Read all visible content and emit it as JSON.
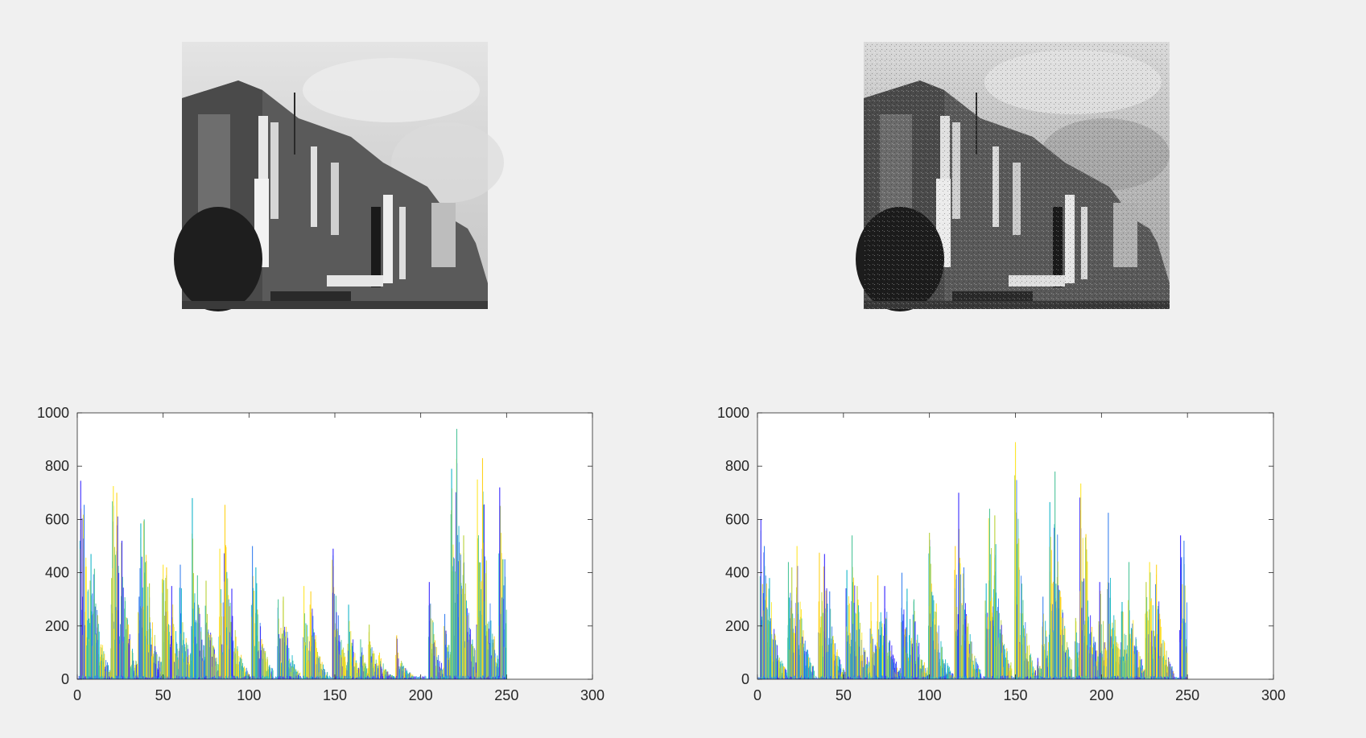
{
  "figure": {
    "background": "#f0f0f0"
  },
  "images": [
    {
      "content": "grayscale photo of building facade with vertical signboards and trees, original"
    },
    {
      "content": "grayscale photo of building facade with vertical signboards and trees, with added noise"
    }
  ],
  "chart_data": [
    {
      "type": "bar",
      "plot_style": "multi-colored histogram lines",
      "xlim": [
        0,
        300
      ],
      "ylim": [
        0,
        1000
      ],
      "xticks": [
        0,
        50,
        100,
        150,
        200,
        250,
        300
      ],
      "yticks": [
        0,
        200,
        400,
        600,
        800,
        1000
      ],
      "colors": [
        "#3a2aff",
        "#3b82f0",
        "#17b7c9",
        "#4ec59a",
        "#b8d23a",
        "#ffe62b",
        "#ffd21c"
      ],
      "bin_range": [
        0,
        250
      ],
      "peaks": [
        {
          "x": 2,
          "y": 745
        },
        {
          "x": 4,
          "y": 655
        },
        {
          "x": 8,
          "y": 470
        },
        {
          "x": 10,
          "y": 415
        },
        {
          "x": 20,
          "y": 380
        },
        {
          "x": 21,
          "y": 725
        },
        {
          "x": 23,
          "y": 700
        },
        {
          "x": 26,
          "y": 520
        },
        {
          "x": 36,
          "y": 310
        },
        {
          "x": 37,
          "y": 585
        },
        {
          "x": 39,
          "y": 600
        },
        {
          "x": 42,
          "y": 360
        },
        {
          "x": 50,
          "y": 430
        },
        {
          "x": 52,
          "y": 420
        },
        {
          "x": 55,
          "y": 350
        },
        {
          "x": 60,
          "y": 430
        },
        {
          "x": 67,
          "y": 680
        },
        {
          "x": 70,
          "y": 390
        },
        {
          "x": 75,
          "y": 370
        },
        {
          "x": 83,
          "y": 490
        },
        {
          "x": 86,
          "y": 655
        },
        {
          "x": 90,
          "y": 340
        },
        {
          "x": 102,
          "y": 500
        },
        {
          "x": 104,
          "y": 420
        },
        {
          "x": 117,
          "y": 300
        },
        {
          "x": 120,
          "y": 310
        },
        {
          "x": 132,
          "y": 350
        },
        {
          "x": 136,
          "y": 330
        },
        {
          "x": 149,
          "y": 490
        },
        {
          "x": 152,
          "y": 240
        },
        {
          "x": 158,
          "y": 280
        },
        {
          "x": 165,
          "y": 150
        },
        {
          "x": 170,
          "y": 205
        },
        {
          "x": 176,
          "y": 100
        },
        {
          "x": 186,
          "y": 165
        },
        {
          "x": 205,
          "y": 365
        },
        {
          "x": 214,
          "y": 245
        },
        {
          "x": 218,
          "y": 790
        },
        {
          "x": 221,
          "y": 940
        },
        {
          "x": 225,
          "y": 540
        },
        {
          "x": 233,
          "y": 750
        },
        {
          "x": 236,
          "y": 830
        },
        {
          "x": 246,
          "y": 720
        },
        {
          "x": 249,
          "y": 450
        }
      ]
    },
    {
      "type": "bar",
      "plot_style": "multi-colored histogram lines",
      "xlim": [
        0,
        300
      ],
      "ylim": [
        0,
        1000
      ],
      "xticks": [
        0,
        50,
        100,
        150,
        200,
        250,
        300
      ],
      "yticks": [
        0,
        200,
        400,
        600,
        800,
        1000
      ],
      "colors": [
        "#3a2aff",
        "#3b82f0",
        "#17b7c9",
        "#4ec59a",
        "#b8d23a",
        "#ffe62b",
        "#ffd21c"
      ],
      "bin_range": [
        0,
        250
      ],
      "peaks": [
        {
          "x": 2,
          "y": 600
        },
        {
          "x": 4,
          "y": 500
        },
        {
          "x": 7,
          "y": 380
        },
        {
          "x": 18,
          "y": 440
        },
        {
          "x": 20,
          "y": 420
        },
        {
          "x": 23,
          "y": 500
        },
        {
          "x": 36,
          "y": 475
        },
        {
          "x": 39,
          "y": 470
        },
        {
          "x": 42,
          "y": 330
        },
        {
          "x": 52,
          "y": 410
        },
        {
          "x": 55,
          "y": 540
        },
        {
          "x": 58,
          "y": 350
        },
        {
          "x": 66,
          "y": 290
        },
        {
          "x": 70,
          "y": 390
        },
        {
          "x": 74,
          "y": 350
        },
        {
          "x": 84,
          "y": 400
        },
        {
          "x": 87,
          "y": 340
        },
        {
          "x": 91,
          "y": 300
        },
        {
          "x": 100,
          "y": 550
        },
        {
          "x": 104,
          "y": 285
        },
        {
          "x": 115,
          "y": 500
        },
        {
          "x": 117,
          "y": 700
        },
        {
          "x": 120,
          "y": 420
        },
        {
          "x": 133,
          "y": 360
        },
        {
          "x": 135,
          "y": 640
        },
        {
          "x": 138,
          "y": 615
        },
        {
          "x": 150,
          "y": 890
        },
        {
          "x": 152,
          "y": 420
        },
        {
          "x": 163,
          "y": 80
        },
        {
          "x": 166,
          "y": 310
        },
        {
          "x": 170,
          "y": 665
        },
        {
          "x": 173,
          "y": 780
        },
        {
          "x": 185,
          "y": 230
        },
        {
          "x": 188,
          "y": 735
        },
        {
          "x": 191,
          "y": 545
        },
        {
          "x": 199,
          "y": 365
        },
        {
          "x": 204,
          "y": 625
        },
        {
          "x": 212,
          "y": 290
        },
        {
          "x": 216,
          "y": 440
        },
        {
          "x": 226,
          "y": 365
        },
        {
          "x": 228,
          "y": 440
        },
        {
          "x": 232,
          "y": 430
        },
        {
          "x": 246,
          "y": 540
        },
        {
          "x": 248,
          "y": 520
        }
      ]
    }
  ]
}
